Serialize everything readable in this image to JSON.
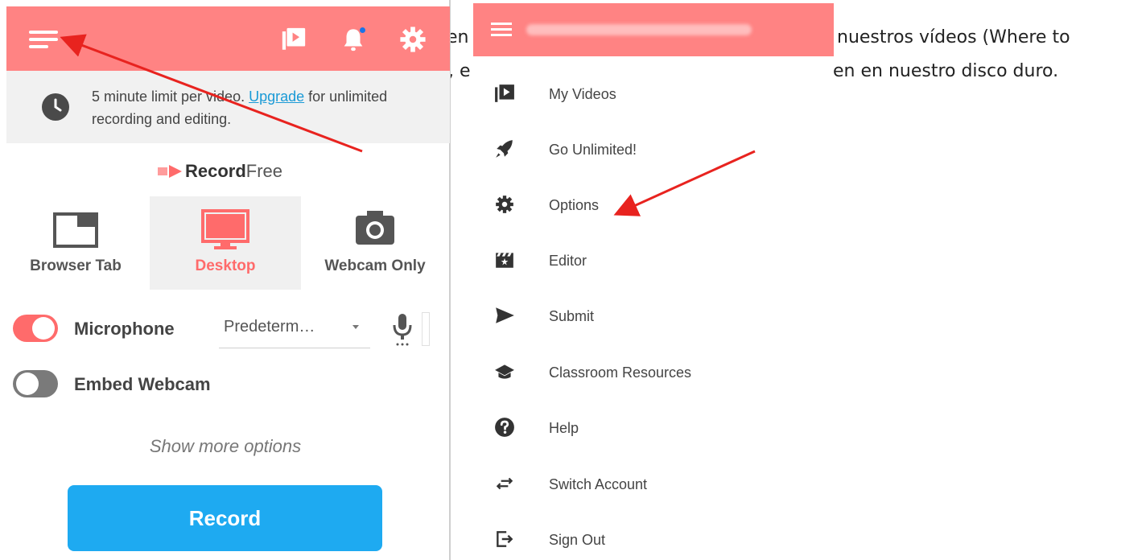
{
  "background": {
    "line1_fragment_a": "en",
    "line1_fragment_b": "nuestros vídeos (Where to",
    "line2_fragment_a": ", e",
    "line2_fragment_b": "en en nuestro disco duro."
  },
  "left_panel": {
    "limit_text_before": "5 minute limit per video. ",
    "limit_link": "Upgrade",
    "limit_text_after": " for unlimited recording and editing.",
    "logo_bold": "Record",
    "logo_light": "Free",
    "modes": [
      {
        "label": "Browser Tab",
        "icon": "browser-tab-icon",
        "active": false
      },
      {
        "label": "Desktop",
        "icon": "desktop-icon",
        "active": true
      },
      {
        "label": "Webcam Only",
        "icon": "camera-icon",
        "active": false
      }
    ],
    "microphone_label": "Microphone",
    "microphone_select": "Predeterm…",
    "embed_webcam_label": "Embed Webcam",
    "show_more": "Show more options",
    "record_button": "Record"
  },
  "menu": {
    "items": [
      {
        "label": "My Videos",
        "icon": "video-library-icon"
      },
      {
        "label": "Go Unlimited!",
        "icon": "rocket-icon"
      },
      {
        "label": "Options",
        "icon": "gear-icon"
      },
      {
        "label": "Editor",
        "icon": "clapperboard-icon"
      },
      {
        "label": "Submit",
        "icon": "send-icon"
      },
      {
        "label": "Classroom Resources",
        "icon": "graduation-cap-icon"
      },
      {
        "label": "Help",
        "icon": "help-icon"
      },
      {
        "label": "Switch Account",
        "icon": "switch-arrows-icon"
      },
      {
        "label": "Sign Out",
        "icon": "sign-out-icon"
      }
    ]
  },
  "colors": {
    "header": "#ff8383",
    "accent": "#ff6b6b",
    "record_button": "#1eaaf1",
    "annotation_arrow": "#e8231f"
  }
}
